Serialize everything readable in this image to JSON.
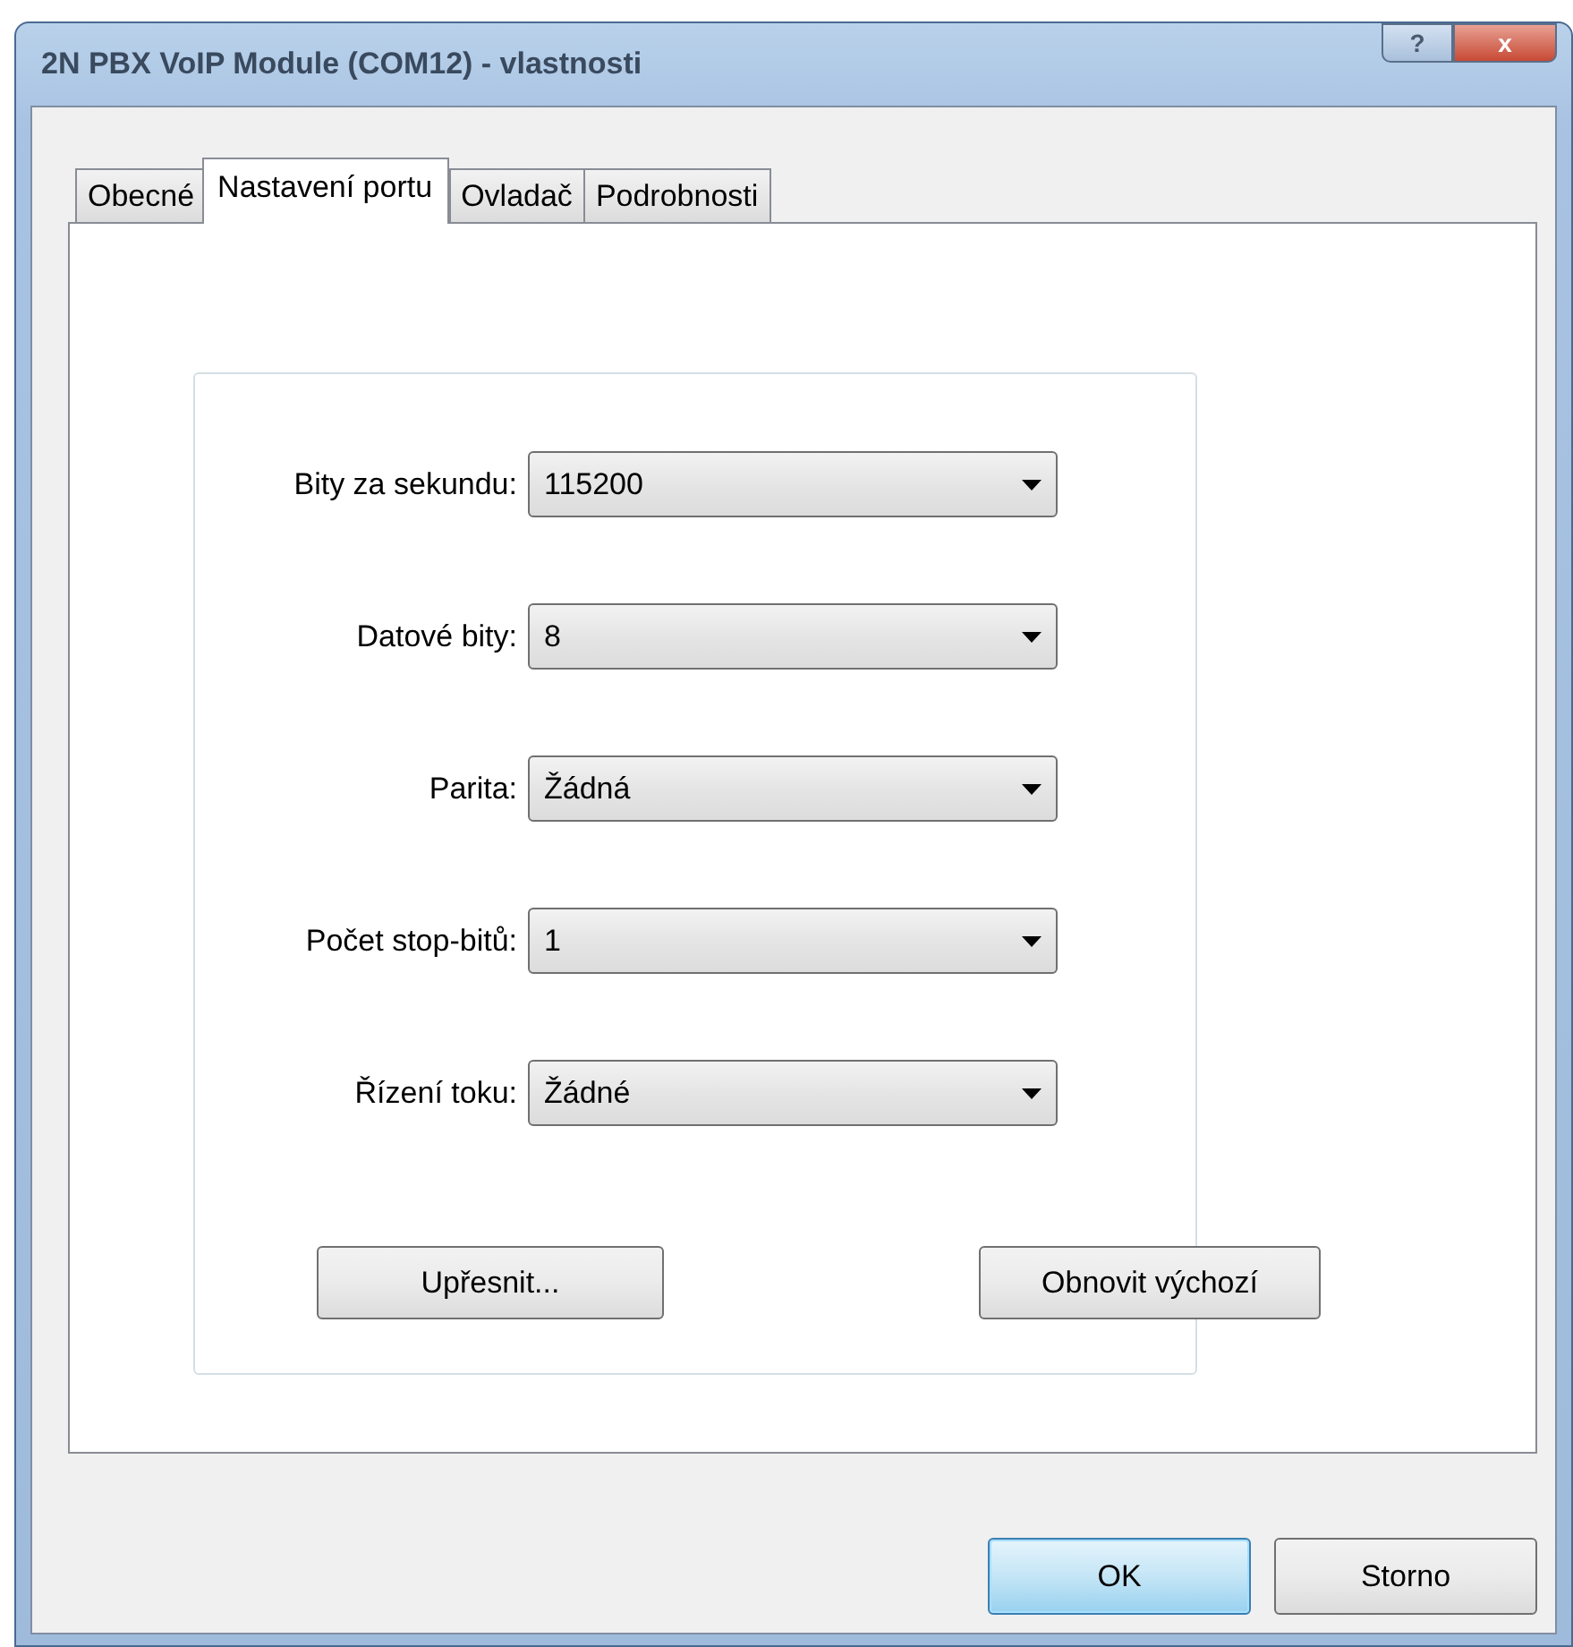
{
  "window": {
    "title": "2N PBX VoIP Module (COM12)  - vlastnosti",
    "help_button": "?",
    "close_button": "x"
  },
  "tabs": [
    {
      "label": "Obecné",
      "selected": false
    },
    {
      "label": "Nastavení portu",
      "selected": true
    },
    {
      "label": "Ovladač",
      "selected": false
    },
    {
      "label": "Podrobnosti",
      "selected": false
    }
  ],
  "settings": [
    {
      "label": "Bity za sekundu:",
      "value": "115200"
    },
    {
      "label": "Datové bity:",
      "value": "8"
    },
    {
      "label": "Parita:",
      "value": "Žádná"
    },
    {
      "label": "Počet stop-bitů:",
      "value": "1"
    },
    {
      "label": "Řízení toku:",
      "value": "Žádné"
    }
  ],
  "panel_buttons": [
    "Upřesnit...",
    "Obnovit výchozí"
  ],
  "dialog_buttons": [
    {
      "label": "OK",
      "default": true
    },
    {
      "label": "Storno",
      "default": false
    }
  ]
}
